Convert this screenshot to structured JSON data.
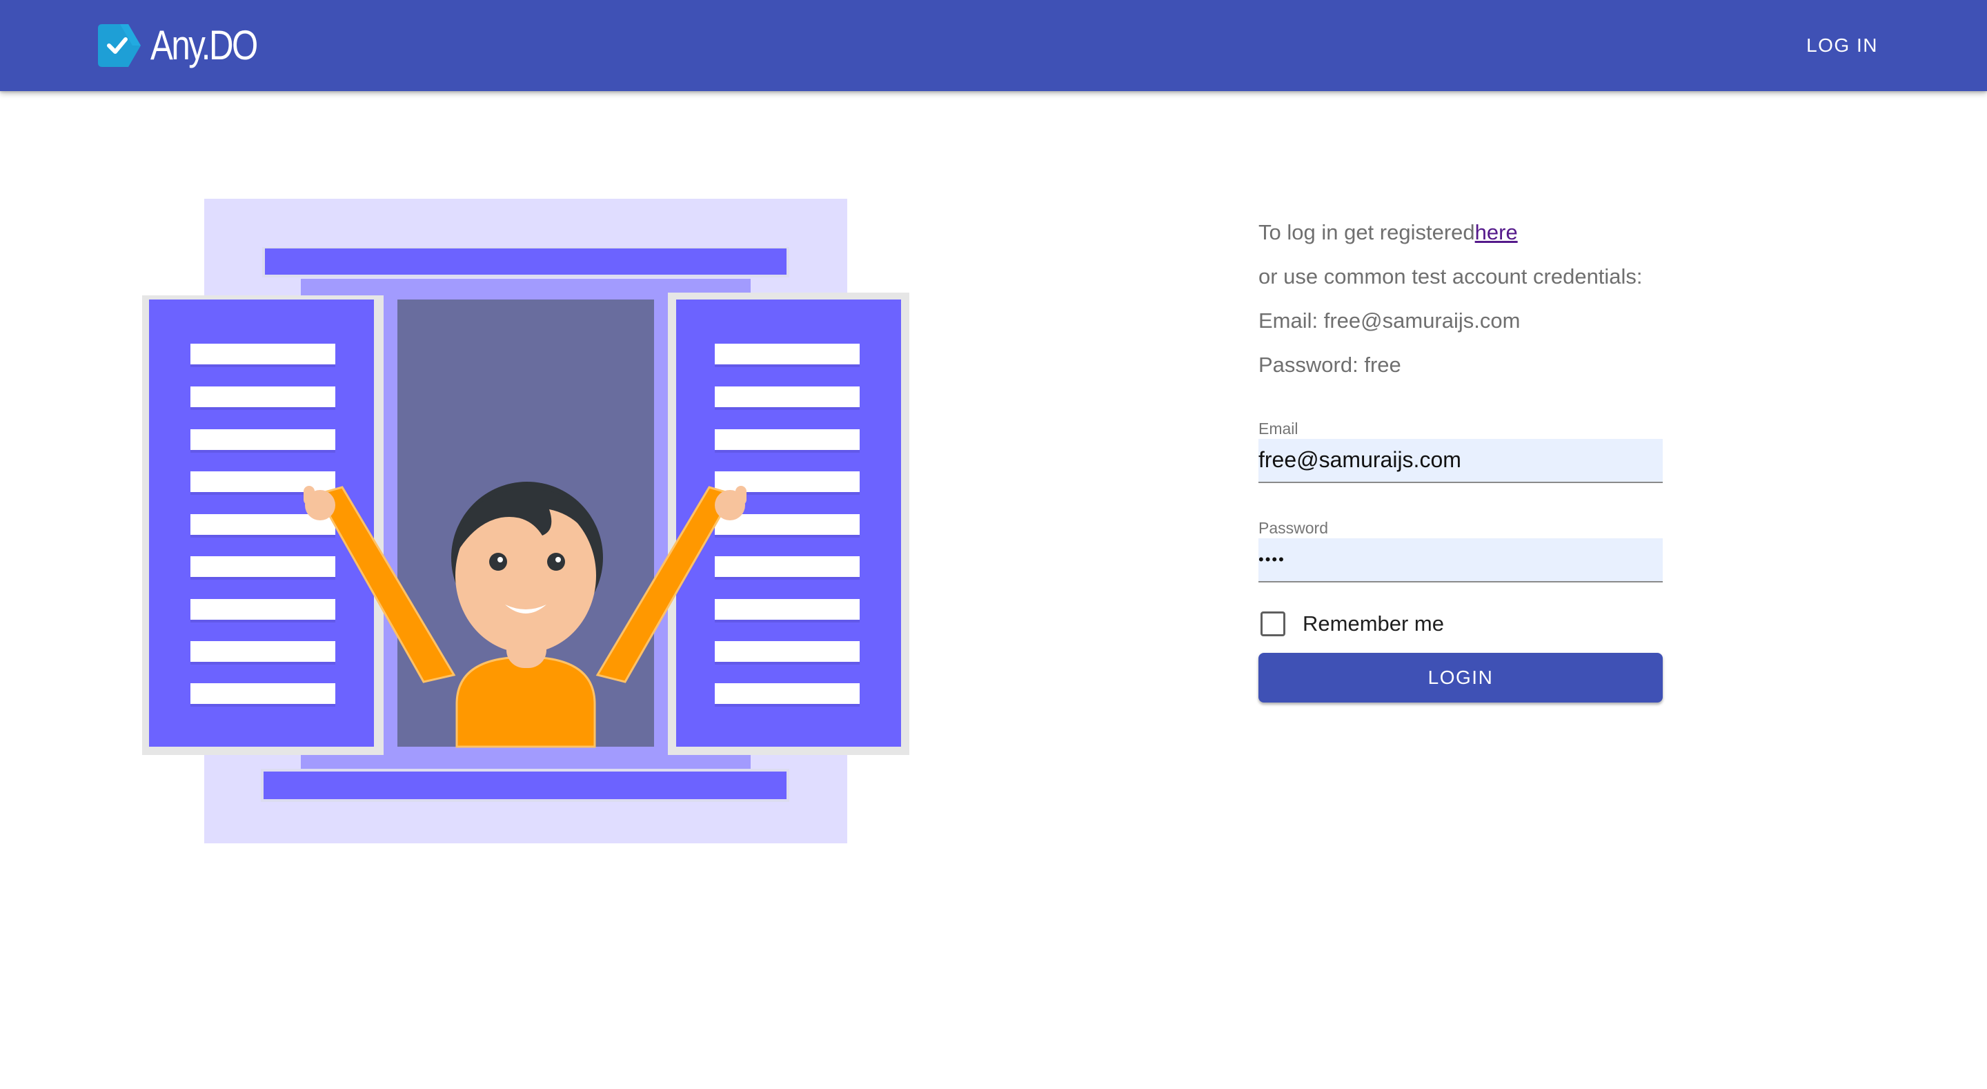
{
  "appbar": {
    "brand_name": "Any.DO",
    "login_link": "LOG IN"
  },
  "info": {
    "register_prefix": "To log in get registered",
    "register_link": "here",
    "line2": "or use common test account credentials:",
    "line3": "Email: free@samuraijs.com",
    "line4": "Password: free"
  },
  "form": {
    "email_label": "Email",
    "email_value": "free@samuraijs.com",
    "password_label": "Password",
    "password_display": "••••",
    "remember_label": "Remember me",
    "remember_checked": false,
    "submit_label": "LOGIN"
  },
  "icons": {
    "brand": "checkmark-tag-icon"
  },
  "colors": {
    "primary": "#3f51b5",
    "autofill_bg": "#e8f0fe",
    "link_visited": "#551a8b",
    "shutter": "#6c63ff",
    "window_bg": "#e0ddff",
    "character_shirt": "#ff9800"
  }
}
